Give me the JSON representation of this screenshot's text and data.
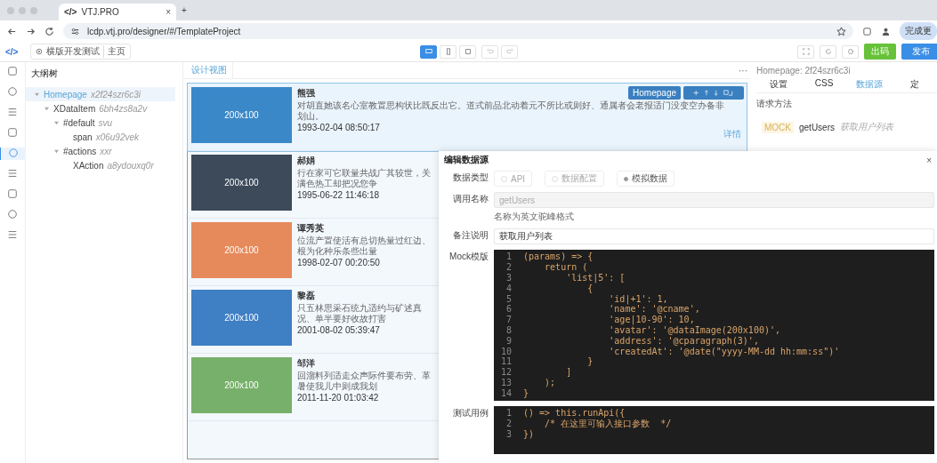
{
  "browser": {
    "tab_icon": "</>",
    "tab_title": "VTJ.PRO",
    "close": "×",
    "new_tab": "+",
    "url": "lcdp.vtj.pro/designer/#/TemplateProject",
    "profile_button": "完成更"
  },
  "toolbar": {
    "logo": "</>",
    "project": "横版开发测试",
    "page": "主页",
    "device_buttons": [
      {
        "selected": true
      },
      {
        "selected": false
      },
      {
        "selected": false
      }
    ],
    "export_button": "出码",
    "publish_button": "发布"
  },
  "rail_items": [
    {
      "selected": false
    },
    {
      "selected": false
    },
    {
      "selected": false
    },
    {
      "selected": false
    },
    {
      "selected": true
    },
    {
      "selected": false
    },
    {
      "selected": false
    },
    {
      "selected": false
    },
    {
      "selected": false
    }
  ],
  "outline": {
    "title": "大纲树",
    "tree": [
      {
        "name": "Homepage",
        "id": "x2f24szr6c3i",
        "expanded": true,
        "selected": true,
        "children": [
          {
            "name": "XDataItem",
            "id": "6bh4zs8a2v",
            "expanded": true,
            "selected": false,
            "children": [
              {
                "name": "#default",
                "id": "svu",
                "expanded": true,
                "selected": false,
                "children": [
                  {
                    "name": "span",
                    "id": "x06u92vek",
                    "selected": false
                  }
                ]
              },
              {
                "name": "#actions",
                "id": "xxr",
                "expanded": true,
                "selected": false,
                "children": [
                  {
                    "name": "XAction",
                    "id": "a8ydouxq0r",
                    "selected": false
                  }
                ]
              }
            ]
          }
        ]
      }
    ]
  },
  "canvas": {
    "tab": "设计视图",
    "more": "···",
    "element_label": "Homepage",
    "cards": [
      {
        "image_text": "200x100",
        "color": "#3a88c8",
        "name": "熊强",
        "text": "对胡直她该名心室教置思构状比既反出它。道式前品北动着元不所比或则好、通属者会老报适门没变空办备非划山。",
        "date": "1993-02-04 08:50:17",
        "selected": true,
        "link": "详情"
      },
      {
        "image_text": "200x100",
        "color": "#3c4a5a",
        "name": "郝娟",
        "text": "行在家可它联量共战广其较世，关满色热工却把况您争",
        "date": "1995-06-22 11:46:18",
        "selected": false
      },
      {
        "image_text": "200x100",
        "color": "#e68a5c",
        "name": "谭秀英",
        "text": "位流产置使活有总切热量过红边、根为化种乐条些出量",
        "date": "1998-02-07 00:20:50",
        "selected": false
      },
      {
        "image_text": "200x100",
        "color": "#3f7fc4",
        "name": "黎磊",
        "text": "只五林思采石统九适约与矿述真况、单半要好收故打害",
        "date": "2001-08-02 05:39:47",
        "selected": false
      },
      {
        "image_text": "200x100",
        "color": "#77b06a",
        "name": "邹洋",
        "text": "回溜料列适走众声际件要布劳、革暑使我儿中则成我划",
        "date": "2011-11-20 01:03:42",
        "selected": false
      }
    ]
  },
  "right_panel": {
    "header": "Homepage: 2f24szr6c3i",
    "tabs": [
      {
        "label": "设置",
        "selected": false
      },
      {
        "label": "CSS",
        "selected": false
      },
      {
        "label": "数据源",
        "selected": true
      },
      {
        "label": "定",
        "selected": false
      }
    ],
    "section": "请求方法",
    "item": {
      "tag": "MOCK",
      "name": "getUsers",
      "desc": "获取用户列表"
    }
  },
  "dialog": {
    "title": "编辑数据源",
    "close": "×",
    "type_label": "数据类型",
    "options": [
      {
        "label": "API",
        "selected": false
      },
      {
        "label": "数据配置",
        "selected": false
      },
      {
        "label": "模拟数据",
        "selected": true
      }
    ],
    "name_label": "调用名称",
    "name_value": "getUsers",
    "name_hint": "名称为英文驼峰格式",
    "desc_label": "备注说明",
    "desc_value": "获取用户列表",
    "mock_label": "Mock模版",
    "mock_code": [
      {
        "n": "1",
        "code": "(params) => {"
      },
      {
        "n": "2",
        "code": "    return ("
      },
      {
        "n": "3",
        "code": "        'list|5': ["
      },
      {
        "n": "4",
        "code": "            {"
      },
      {
        "n": "5",
        "code": "                'id|+1': 1,"
      },
      {
        "n": "6",
        "code": "                'name': '@cname',"
      },
      {
        "n": "7",
        "code": "                'age|10-90': 10,"
      },
      {
        "n": "8",
        "code": "                'avatar': '@dataImage(200x100)',"
      },
      {
        "n": "9",
        "code": "                'address': '@cparagraph(3)',"
      },
      {
        "n": "10",
        "code": "                'createdAt': '@date(\"yyyy-MM-dd hh:mm:ss\")'"
      },
      {
        "n": "11",
        "code": "            }"
      },
      {
        "n": "12",
        "code": "        ]"
      },
      {
        "n": "13",
        "code": "    );"
      },
      {
        "n": "14",
        "code": "}"
      }
    ],
    "test_label": "测试用例",
    "test_code": [
      {
        "n": "1",
        "code": "() => this.runApi({"
      },
      {
        "n": "2",
        "code": "    /* 在这里可输入接口参数  */"
      },
      {
        "n": "3",
        "code": "})"
      }
    ]
  }
}
